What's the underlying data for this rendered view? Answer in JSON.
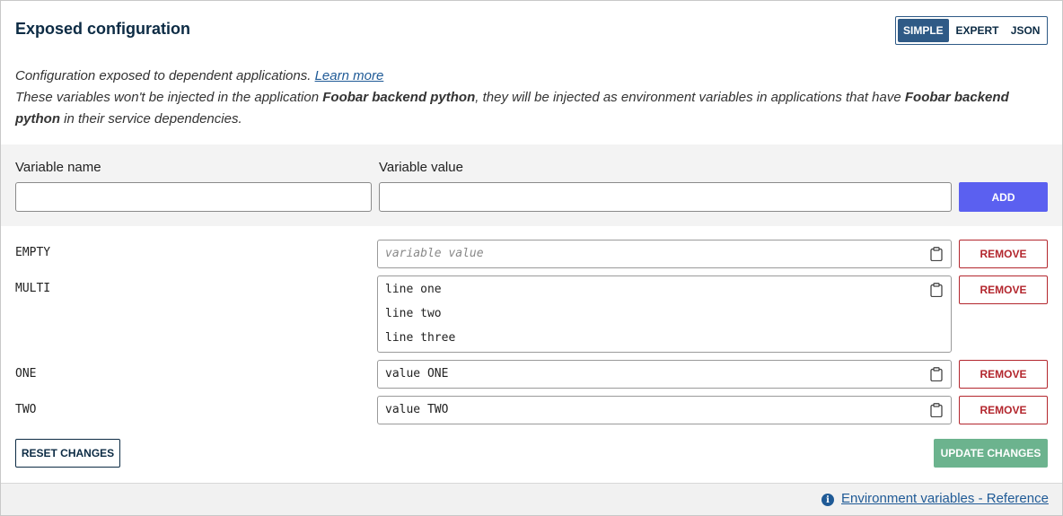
{
  "header": {
    "title": "Exposed configuration",
    "modes": [
      {
        "label": "SIMPLE",
        "active": true
      },
      {
        "label": "EXPERT",
        "active": false
      },
      {
        "label": "JSON",
        "active": false
      }
    ]
  },
  "description": {
    "line1_text": "Configuration exposed to dependent applications. ",
    "learn_more": "Learn more",
    "line2_part1": "These variables won't be injected in the application ",
    "app_name": "Foobar backend python",
    "line2_part2": ", they will be injected as environment variables in applications that have ",
    "line2_part3": " in their service dependencies."
  },
  "add_form": {
    "name_label": "Variable name",
    "value_label": "Variable value",
    "name_value": "",
    "value_value": "",
    "add_label": "ADD"
  },
  "variables": [
    {
      "name": "EMPTY",
      "value_placeholder": "variable value",
      "lines": []
    },
    {
      "name": "MULTI",
      "lines": [
        "line one",
        "line two",
        "line three"
      ]
    },
    {
      "name": "ONE",
      "lines": [
        "value ONE"
      ]
    },
    {
      "name": "TWO",
      "lines": [
        "value TWO"
      ]
    }
  ],
  "remove_label": "REMOVE",
  "actions": {
    "reset_label": "RESET CHANGES",
    "update_label": "UPDATE CHANGES"
  },
  "footer": {
    "link_label": "Environment variables - Reference",
    "info_icon": "info-icon"
  },
  "colors": {
    "primary": "#5b60f0",
    "danger": "#b3262d",
    "success": "#6cb38e",
    "navy": "#0c2b44",
    "link": "#1f5a96"
  }
}
